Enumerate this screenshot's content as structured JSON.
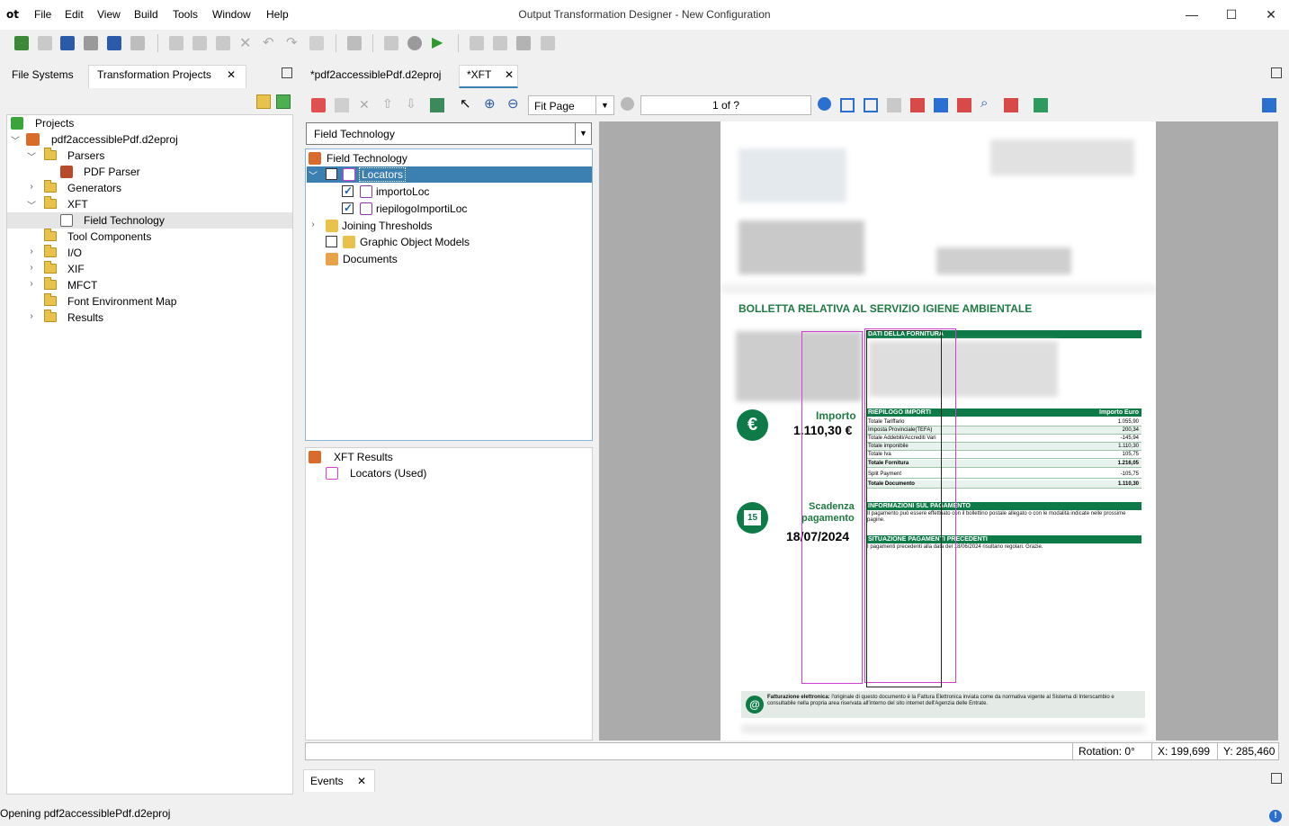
{
  "window": {
    "logo": "ot",
    "title": "Output Transformation Designer - New Configuration",
    "minimize": "—",
    "maximize": "☐",
    "close": "✕"
  },
  "menu": [
    "File",
    "Edit",
    "View",
    "Build",
    "Tools",
    "Window",
    "Help"
  ],
  "left_panel": {
    "tabs": [
      "File Systems",
      "Transformation Projects"
    ],
    "tab_close": "✕",
    "tree": {
      "root": "Projects",
      "project": "pdf2accessiblePdf.d2eproj",
      "parsers": "Parsers",
      "pdf_parser": "PDF Parser",
      "generators": "Generators",
      "xft": "XFT",
      "field_technology": "Field Technology",
      "tool_components": "Tool Components",
      "io": "I/O",
      "xif": "XIF",
      "mfct": "MFCT",
      "font_env": "Font Environment Map",
      "results": "Results"
    }
  },
  "editor": {
    "tabs": [
      "*pdf2accessiblePdf.d2eproj",
      "*XFT"
    ],
    "tab_close": "✕",
    "zoom_option": "Fit Page",
    "page_indicator": "1 of ?",
    "combo_value": "Field Technology",
    "ft_tree": {
      "root": "Field Technology",
      "locators": "Locators",
      "importo_loc": "importoLoc",
      "riepilogo_loc": "riepilogoImportiLoc",
      "joining": "Joining Thresholds",
      "graphic_models": "Graphic Object Models",
      "documents": "Documents"
    },
    "results_tree": {
      "root": "XFT Results",
      "locators_used": "Locators (Used)"
    }
  },
  "document": {
    "heading": "BOLLETTA RELATIVA AL SERVIZIO IGIENE AMBIENTALE",
    "importo_label": "Importo",
    "importo_value": "1.110,30 €",
    "scadenza_label_1": "Scadenza",
    "scadenza_label_2": "pagamento",
    "scadenza_value": "18/07/2024",
    "calendar_day": "15",
    "euro_symbol": "€",
    "dati_fornitura": "DATI DELLA FORNITURA",
    "riepilogo_importi": "RIEPILOGO IMPORTI",
    "importo_euro": "Importo Euro",
    "rows": [
      {
        "label": "Totale Tariffario",
        "value": "1.055,90"
      },
      {
        "label": "Imposta Provinciale(TEFA)",
        "value": "200,34"
      },
      {
        "label": "Totale Addebiti/Accrediti Vari",
        "value": "-145,94"
      },
      {
        "label": "Totale imponibile",
        "value": "1.110,30"
      },
      {
        "label": "Totale Iva",
        "value": "105,75"
      },
      {
        "label": "Totale Fornitura",
        "value": "1.216,05"
      },
      {
        "label": "Split Payment",
        "value": "-105,75"
      },
      {
        "label": "Totale Documento",
        "value": "1.110,30"
      }
    ],
    "info_pagamento": "INFORMAZIONI SUL PAGAMENTO",
    "info_text": "Il pagamento può essere effettuato con il bollettino postale allegato o con le modalità indicate nelle prossime pagine.",
    "situazione": "SITUAZIONE PAGAMENTI PRECEDENTI",
    "situazione_text": "I pagamenti precedenti alla data del 18/06/2024 risultano regolari. Grazie.",
    "fattura_bold": "Fatturazione elettronica:",
    "fattura_text": " l'originale di questo documento è la Fattura Elettronica inviata come da normativa vigente al Sistema di Interscambio e consultabile nella propria area riservata all'interno del sito internet dell'Agenzia delle Entrate.",
    "at_symbol": "@"
  },
  "status": {
    "rotation": "Rotation: 0°",
    "x": "X: 199,699",
    "y": "Y: 285,460"
  },
  "events_tab": "Events",
  "bottom_status": "Opening pdf2accessiblePdf.d2eproj",
  "colors": {
    "accent": "#0d7a47",
    "selection": "#3c7fb1",
    "locator_box": "#d33fd3"
  }
}
